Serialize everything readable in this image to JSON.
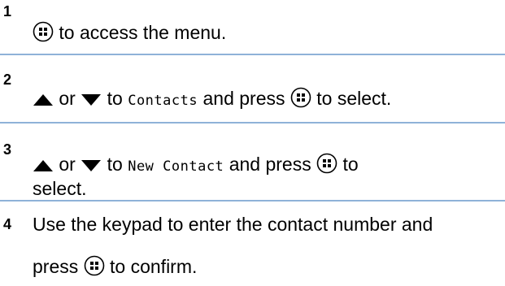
{
  "colors": {
    "rule": "#8fb2d8",
    "text": "#000000"
  },
  "icons": {
    "menu_button": "menu-ok-button-icon",
    "up": "up-arrow-icon",
    "down": "down-arrow-icon"
  },
  "steps": [
    {
      "number": "1",
      "text": "to access the menu."
    },
    {
      "number": "2",
      "or": "or",
      "to": "to",
      "menu_item": "Contacts",
      "and_press": "and press",
      "to_select": "to select."
    },
    {
      "number": "3",
      "or": "or",
      "to": "to",
      "menu_item": "New Contact",
      "and_press": "and press",
      "select": "select."
    },
    {
      "number": "4",
      "line1": "Use the keypad to enter the contact number and",
      "press": "press",
      "to_confirm": "to confirm."
    }
  ]
}
